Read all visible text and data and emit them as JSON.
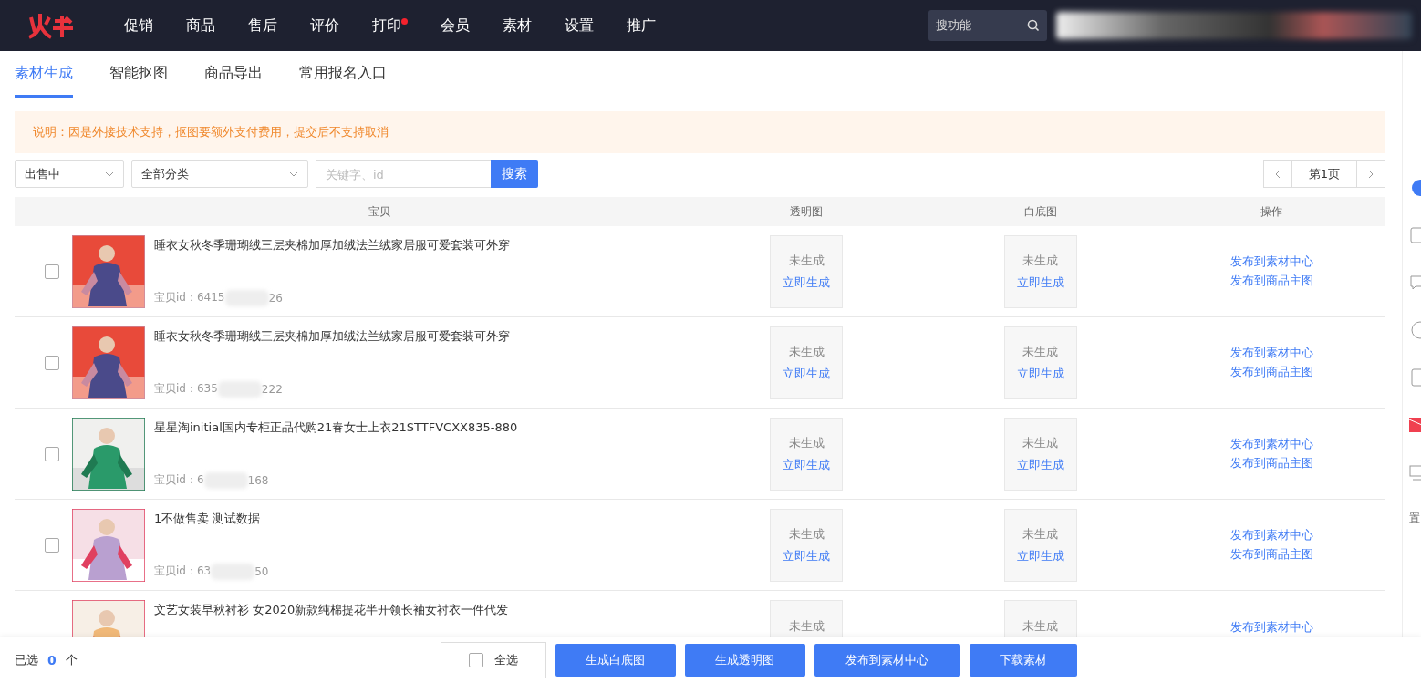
{
  "nav": {
    "items": [
      {
        "label": "促销",
        "dot": false
      },
      {
        "label": "商品",
        "dot": false
      },
      {
        "label": "售后",
        "dot": false
      },
      {
        "label": "评价",
        "dot": false
      },
      {
        "label": "打印",
        "dot": true
      },
      {
        "label": "会员",
        "dot": false
      },
      {
        "label": "素材",
        "dot": false
      },
      {
        "label": "设置",
        "dot": false
      },
      {
        "label": "推广",
        "dot": false
      }
    ],
    "search": {
      "placeholder": "搜功能"
    }
  },
  "tabs": [
    {
      "label": "素材生成",
      "selected": true
    },
    {
      "label": "智能抠图",
      "selected": false
    },
    {
      "label": "商品导出",
      "selected": false
    },
    {
      "label": "常用报名入口",
      "selected": false
    }
  ],
  "notice": "说明：因是外接技术支持，抠图要额外支付费用，提交后不支持取消",
  "filters": {
    "status": "出售中",
    "category": "全部分类",
    "keyword_placeholder": "关键字、id",
    "search_button": "搜索",
    "page": "第1页"
  },
  "table": {
    "columns": [
      "宝贝",
      "透明图",
      "白底图",
      "操作"
    ],
    "rows": [
      {
        "checked": false,
        "title": "睡衣女秋冬季珊瑚绒三层夹棉加厚加绒法兰绒家居服可爱套装可外穿",
        "id_prefix": "宝贝id：6415",
        "id_suffix": "26",
        "transparent": {
          "status": "未生成",
          "action": "立即生成"
        },
        "white": {
          "status": "未生成",
          "action": "立即生成"
        },
        "links": [
          "发布到素材中心",
          "发布到商品主图"
        ]
      },
      {
        "checked": false,
        "title": "睡衣女秋冬季珊瑚绒三层夹棉加厚加绒法兰绒家居服可爱套装可外穿",
        "id_prefix": "宝贝id：635",
        "id_suffix": "222",
        "transparent": {
          "status": "未生成",
          "action": "立即生成"
        },
        "white": {
          "status": "未生成",
          "action": "立即生成"
        },
        "links": [
          "发布到素材中心",
          "发布到商品主图"
        ]
      },
      {
        "checked": false,
        "title": "星星淘initial国内专柜正品代购21春女士上衣21STTFVCXX835-880",
        "id_prefix": "宝贝id：6",
        "id_suffix": "168",
        "transparent": {
          "status": "未生成",
          "action": "立即生成"
        },
        "white": {
          "status": "未生成",
          "action": "立即生成"
        },
        "links": [
          "发布到素材中心",
          "发布到商品主图"
        ]
      },
      {
        "checked": false,
        "title": "1不做售卖 测试数据",
        "id_prefix": "宝贝id：63",
        "id_suffix": "50",
        "transparent": {
          "status": "未生成",
          "action": "立即生成"
        },
        "white": {
          "status": "未生成",
          "action": "立即生成"
        },
        "links": [
          "发布到素材中心",
          "发布到商品主图"
        ]
      },
      {
        "title": "文艺女装早秋衬衫 女2020新款纯棉提花半开领长袖女衬衣一件代发",
        "transparent": {
          "status": "未生成"
        },
        "white": {
          "status": "未生成"
        },
        "links": [
          "发布到素材中心"
        ]
      }
    ]
  },
  "side_label": "置",
  "footer": {
    "selected_label": "已选",
    "selected_count": "0",
    "unit": "个",
    "select_all": {
      "label": "全选",
      "checked": false
    },
    "buttons": [
      "生成白底图",
      "生成透明图",
      "发布到素材中心",
      "下载素材"
    ]
  }
}
